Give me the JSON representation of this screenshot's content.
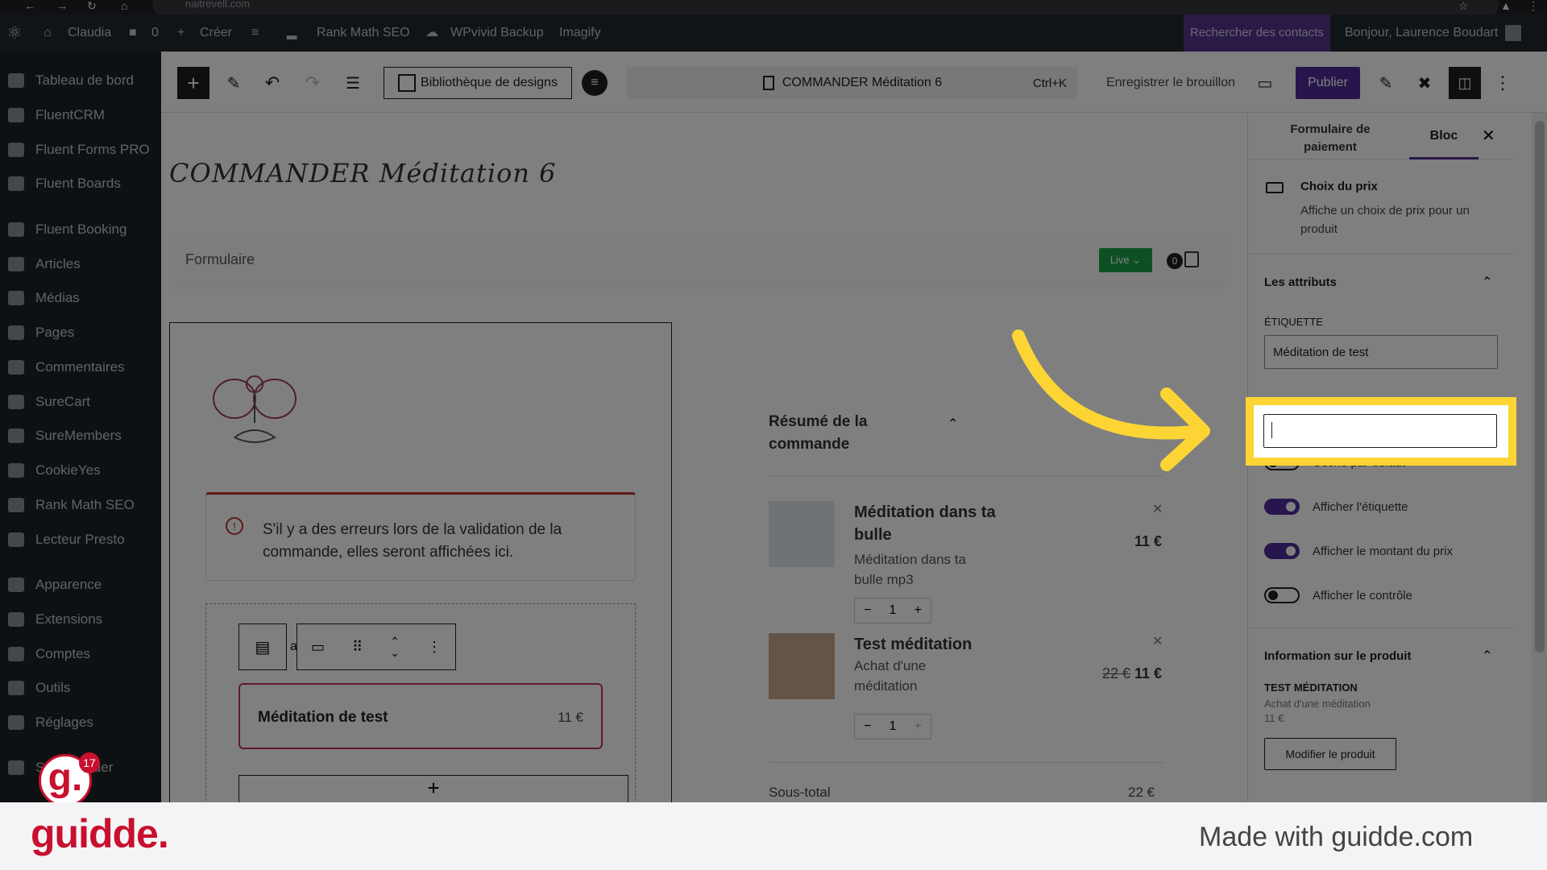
{
  "browser": {
    "url": "naitrevell.com"
  },
  "adminbar": {
    "site": "Claudia",
    "comments": "0",
    "create": "Créer",
    "rankmath": "Rank Math SEO",
    "wpvivid": "WPvivid Backup",
    "imagify": "Imagify",
    "search_contacts": "Rechercher des contacts",
    "greeting": "Bonjour, Laurence Boudart"
  },
  "sidebar": {
    "items": [
      {
        "label": "Tableau de bord"
      },
      {
        "label": "FluentCRM"
      },
      {
        "label": "Fluent Forms PRO"
      },
      {
        "label": "Fluent Boards"
      },
      {
        "label": "Fluent Booking"
      },
      {
        "label": "Articles"
      },
      {
        "label": "Médias"
      },
      {
        "label": "Pages"
      },
      {
        "label": "Commentaires"
      },
      {
        "label": "SureCart"
      },
      {
        "label": "SureMembers"
      },
      {
        "label": "CookieYes"
      },
      {
        "label": "Rank Math SEO"
      },
      {
        "label": "Lecteur Presto"
      },
      {
        "label": "Apparence"
      },
      {
        "label": "Extensions"
      },
      {
        "label": "Comptes"
      },
      {
        "label": "Outils"
      },
      {
        "label": "Réglages"
      },
      {
        "label": "S     zBuilder"
      }
    ]
  },
  "toolbar": {
    "design_library": "Bibliothèque de designs",
    "doc_title": "COMMANDER Méditation 6",
    "shortcut": "Ctrl+K",
    "save_draft": "Enregistrer le brouillon",
    "publish": "Publier"
  },
  "canvas": {
    "page_title": "COMMANDER Méditation 6",
    "form_label": "Formulaire",
    "live_badge": "Live",
    "cart_count": "0",
    "error_notice": "S'il y a des erreurs lors de la validation de la commande, elles seront affichées ici.",
    "price_choice_label": "Méditation de test",
    "price_choice_amount": "11 €",
    "block_letter": "a",
    "summary_title": "Résumé de la commande",
    "items": [
      {
        "name": "Méditation dans ta bulle",
        "desc": "Méditation dans ta bulle mp3",
        "qty": "1",
        "price": "11 €",
        "old_price": ""
      },
      {
        "name": "Test méditation",
        "desc": "Achat d'une méditation",
        "qty": "1",
        "price": "11 €",
        "old_price": "22 €"
      }
    ],
    "subtotal_label": "Sous-total",
    "subtotal_value": "22 €"
  },
  "panel": {
    "tab_form": "Formulaire de paiement",
    "tab_block": "Bloc",
    "block_name": "Choix du prix",
    "block_desc": "Affiche un choix de prix pour un produit",
    "attributes_title": "Les attributs",
    "label_caption": "ÉTIQUETTE",
    "label_value": "Méditation de test",
    "second_input_value": "",
    "toggles": [
      {
        "label": "Coché par défaut",
        "on": false
      },
      {
        "label": "Afficher l'étiquette",
        "on": true
      },
      {
        "label": "Afficher le montant du prix",
        "on": true
      },
      {
        "label": "Afficher le contrôle",
        "on": false
      }
    ],
    "product_info_title": "Information sur le produit",
    "product_name": "TEST MÉDITATION",
    "product_desc": "Achat d'une méditation",
    "product_price": "11 €",
    "edit_button": "Modifier le produit"
  },
  "footer": {
    "brand": "guidde.",
    "made_with": "Made with guidde.com",
    "badge_count": "17"
  },
  "colors": {
    "accent": "#4f2d9a",
    "highlight": "#fcd535",
    "live_green": "#1aa347",
    "brand_red": "#c8102e"
  }
}
